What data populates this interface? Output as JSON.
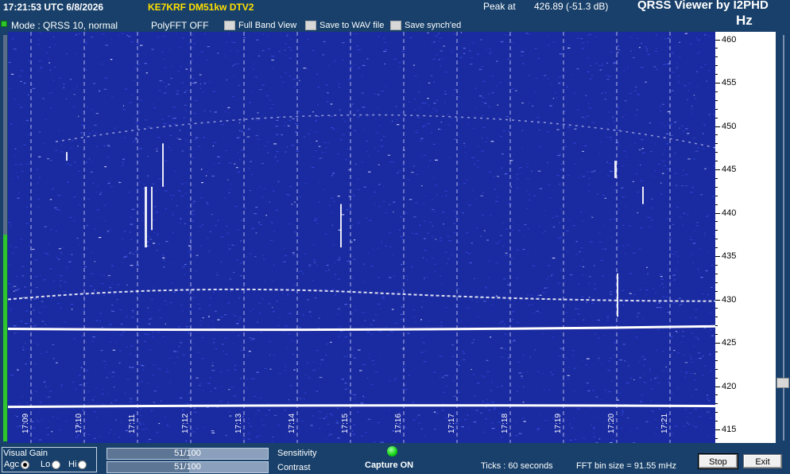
{
  "header": {
    "clock": "17:21:53 UTC  6/8/2026",
    "callsign": "KE7KRF DM51kw DTV2",
    "peak_label": "Peak at",
    "peak_value": "426.89 (-51.3 dB)",
    "app_title": "QRSS Viewer by I2PHD",
    "unit": "Hz"
  },
  "toolbar": {
    "mode": "Mode : QRSS 10, normal",
    "polyfft": "PolyFFT OFF",
    "full_band_view": "Full Band View",
    "save_wav": "Save to WAV file",
    "save_synch": "Save synch'ed"
  },
  "waterfall": {
    "time_labels": [
      "17:09",
      "17:10",
      "17:11",
      "17:12",
      "17:13",
      "17:14",
      "17:15",
      "17:16",
      "17:17",
      "17:18",
      "17:19",
      "17:20",
      "17:21"
    ],
    "freq_labels": [
      "460",
      "455",
      "450",
      "445",
      "440",
      "435",
      "430",
      "425",
      "420",
      "415"
    ],
    "colors": {
      "background": "#1a2aa0",
      "trace": "#ffffff",
      "grid": "#d8dcff"
    }
  },
  "controls": {
    "visual_gain_title": "Visual Gain",
    "agc": "Agc",
    "lo": "Lo",
    "hi": "Hi",
    "selected_gain": "Agc",
    "sensitivity_value": "51/100",
    "contrast_value": "51/100",
    "sensitivity_label": "Sensitivity",
    "contrast_label": "Contrast",
    "sensitivity_level": 0.51,
    "contrast_level": 0.51,
    "capture_status": "Capture ON",
    "ticks": "Ticks   : 60 seconds",
    "fft_bin": "FFT bin size = 91.55 mHz",
    "stop_label": "Stop",
    "exit_label": "Exit"
  }
}
